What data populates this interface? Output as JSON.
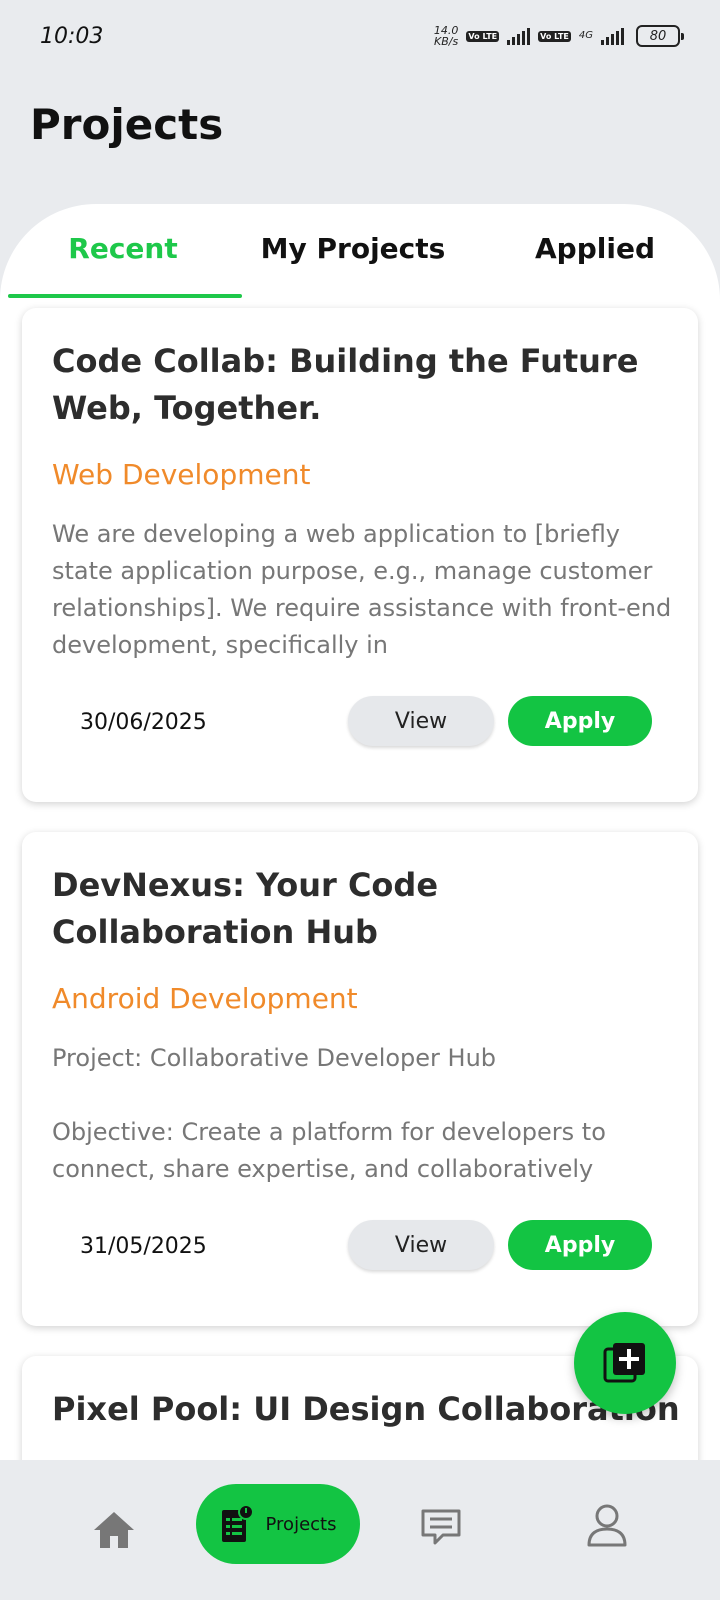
{
  "status_bar": {
    "time": "10:03",
    "net_speed_value": "14.0",
    "net_speed_unit": "KB/s",
    "volte_1": "Vo LTE",
    "volte_2": "Vo LTE",
    "network_type": "4G",
    "battery": "80"
  },
  "header": {
    "title": "Projects"
  },
  "tabs": [
    {
      "label": "Recent",
      "active": true
    },
    {
      "label": "My Projects",
      "active": false
    },
    {
      "label": "Applied",
      "active": false
    }
  ],
  "projects": [
    {
      "title": "Code Collab: Building the Future Web, Together.",
      "category": "Web Development",
      "description": "We are developing a web application to [briefly state application purpose, e.g., manage customer relationships]. We require assistance with front-end development, specifically in",
      "date": "30/06/2025",
      "view_label": "View",
      "apply_label": "Apply"
    },
    {
      "title": "DevNexus: Your Code Collaboration Hub",
      "category": "Android Development",
      "description": "Project: Collaborative Developer Hub\n\nObjective: Create a platform for developers to connect, share expertise, and collaboratively",
      "date": "31/05/2025",
      "view_label": "View",
      "apply_label": "Apply"
    },
    {
      "title": "Pixel Pool: UI Design Collaboration"
    }
  ],
  "bottom_nav": {
    "home_icon": "home-icon",
    "projects_label": "Projects",
    "messages_icon": "message-icon",
    "profile_icon": "profile-icon"
  },
  "colors": {
    "accent_green": "#13c443",
    "category_orange": "#f08a2a",
    "background": "#e9ebee"
  }
}
